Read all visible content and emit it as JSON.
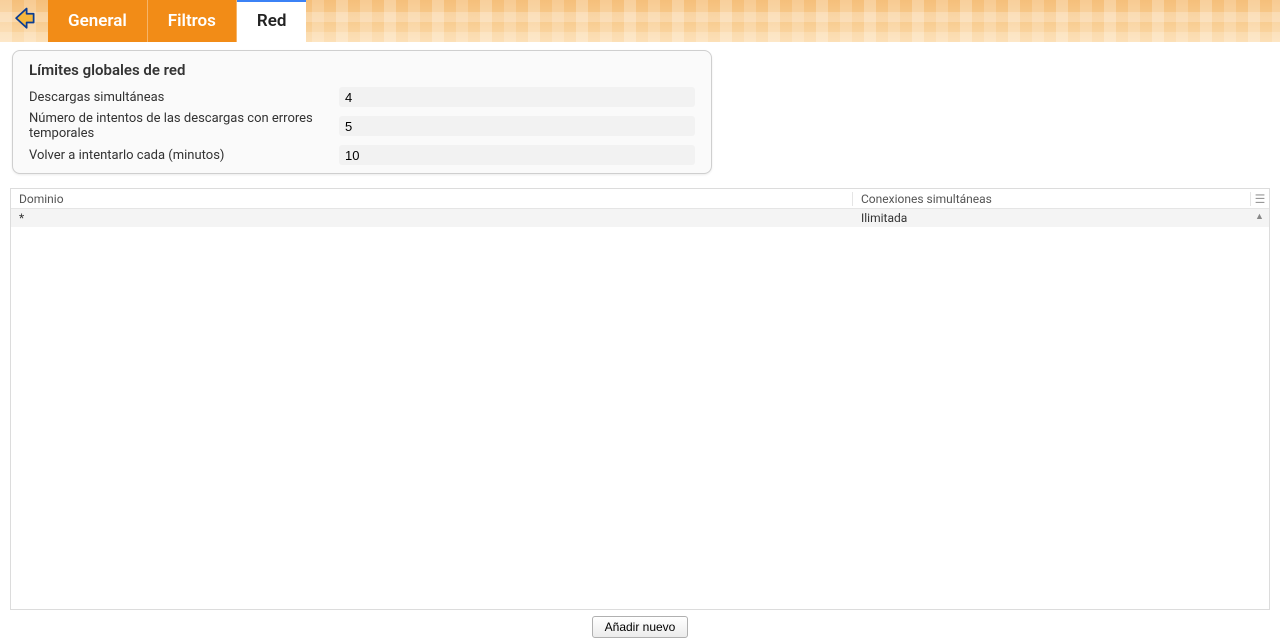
{
  "tabs": {
    "general": "General",
    "filtros": "Filtros",
    "red": "Red"
  },
  "panel": {
    "title": "Límites globales de red",
    "fields": {
      "descargas_label": "Descargas simultáneas",
      "descargas_value": "4",
      "intentos_label": "Número de intentos de las descargas con errores temporales",
      "intentos_value": "5",
      "reintentar_label": "Volver a intentarlo cada (minutos)",
      "reintentar_value": "10"
    }
  },
  "grid": {
    "header": {
      "dominio": "Dominio",
      "conexiones": "Conexiones simultáneas"
    },
    "rows": [
      {
        "dominio": "*",
        "conexiones": "Ilimitada"
      }
    ]
  },
  "footer": {
    "add": "Añadir nuevo"
  }
}
